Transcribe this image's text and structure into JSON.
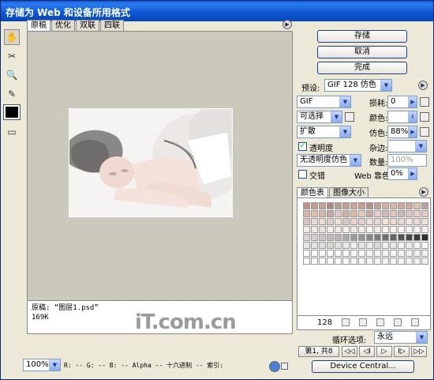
{
  "window": {
    "title": "存储为 Web 和设备所用格式"
  },
  "tools": [
    {
      "icon": "hand-icon",
      "glyph": "✋"
    },
    {
      "icon": "slice-select-icon",
      "glyph": "✂"
    },
    {
      "icon": "zoom-icon",
      "glyph": "🔍"
    },
    {
      "icon": "eyedropper-icon",
      "glyph": "✎"
    }
  ],
  "view_tabs": [
    "原稿",
    "优化",
    "双联",
    "四联"
  ],
  "info": {
    "line1": "原稿: “图层1.psd”",
    "line2": "169K"
  },
  "watermark": "iT.com.cn",
  "buttons": {
    "save": "存储",
    "cancel": "取消",
    "done": "完成",
    "device_central": "Device Central..."
  },
  "settings": {
    "preset_label": "预设:",
    "preset_value": "GIF 128 仿色",
    "format": "GIF",
    "lossy_label": "损耗:",
    "lossy_value": "0",
    "reduction": "可选择",
    "colors_label": "颜色:",
    "colors_value": "",
    "dither_algo": "扩散",
    "dither_label": "仿色:",
    "dither_value": "88%",
    "transparency_label": "透明度",
    "matte_label": "杂边:",
    "transparency_dither": "无透明度仿色",
    "amount_label": "数量:",
    "amount_value": "100%",
    "interlaced_label": "交错",
    "websnap_label": "Web 靠色:",
    "websnap_value": "0%"
  },
  "color_tabs": [
    "颜色表",
    "图像大小"
  ],
  "color_table": {
    "count": "128",
    "swatches": [
      "#c1928a",
      "#c79a8d",
      "#c5a39a",
      "#ad8c84",
      "#b89e95",
      "#c69c90",
      "#d1a697",
      "#ce9b8b",
      "#b38f88",
      "#c0a29c",
      "#d6b3a6",
      "#dcb6a5",
      "#d3a798",
      "#cfaa9c",
      "#e2c2b5",
      "#bba49f",
      "#d8b3a3",
      "#e3bda9",
      "#d9b5a7",
      "#c3a7a0",
      "#e0c9c0",
      "#cdb0a6",
      "#dfb8a4",
      "#e8c9b9",
      "#c4aaa4",
      "#e9cfc3",
      "#d2b9b1",
      "#e3c4b5",
      "#cfb8b2",
      "#ddc7c0",
      "#ebd3c7",
      "#e5ccbf",
      "#d8c2bb",
      "#eed7cb",
      "#f0dacd",
      "#e3ccc3",
      "#f1ddd1",
      "#dbc8c2",
      "#ecd5c8",
      "#e6d2ca",
      "#f3e0d5",
      "#e7d8d2",
      "#f5e4da",
      "#efdcd1",
      "#e9d9d3",
      "#f6e7de",
      "#ebdcd6",
      "#f1e2da",
      "#f7eae2",
      "#f4e6de",
      "#eee1dc",
      "#f8ede6",
      "#f3e9e4",
      "#faf0ea",
      "#f0e6e2",
      "#f6ede8",
      "#fbf3ee",
      "#f5eeea",
      "#fcf6f2",
      "#f8f2ef",
      "#fdf9f6",
      "#faf6f3",
      "#fefbf9",
      "#f6f2f0",
      "#dcd6d4",
      "#d3cfce",
      "#c8c6c5",
      "#bfbcbc",
      "#b5b3b3",
      "#aaa8a8",
      "#9f9d9d",
      "#949292",
      "#898787",
      "#7d7c7c",
      "#716f6f",
      "#656363",
      "#585757",
      "#4b4a4a",
      "#3d3c3c",
      "#2e2d2d",
      "#eae6e4",
      "#e4e1e0",
      "#dfdddc",
      "#d9d7d6",
      "#e7e1dd",
      "#ede8e5",
      "#f2eeeb",
      "#e9e5e3",
      "#efebe9",
      "#e1dbd8",
      "#f4f1ef",
      "#ebe7e5",
      "#f6f4f2",
      "#f0edeb",
      "#f9f7f5",
      "#fbfaf9",
      "#ffffff",
      "#fffefe",
      "#fffdfc",
      "#fefcfb",
      "#fdfbfa",
      "#fcfaf9",
      "#fbf9f8",
      "#faf8f7",
      "#f9f7f6",
      "#f8f6f5",
      "#f7f5f4",
      "#f6f4f3",
      "#f5f3f2",
      "#f4f2f1",
      "#f3f1f0",
      "#f2f0ef",
      "#fefefe",
      "#fdfdfd",
      "#fcfcfc",
      "#fbfbfb",
      "#fafafa",
      "#f9f9f9",
      "#f8f8f8",
      "#f7f7f7",
      "#f6f6f6",
      "#f5f5f5",
      "#f4f4f4",
      "#f3f3f3",
      "#f2f2f2",
      "#f1f1f1",
      "#f0f0f0",
      "#efefef"
    ]
  },
  "loop": {
    "label": "循环选项:",
    "value": "永远"
  },
  "anim": {
    "frame": "第1, 共8",
    "buttons": [
      "◁◁",
      "◁I",
      "▷",
      "I▷",
      "▷▷"
    ]
  },
  "statusbar": {
    "zoom": "100%",
    "readout": "R: --  G: --  B: --  Alpha --  十六进制  -- 索引:"
  }
}
